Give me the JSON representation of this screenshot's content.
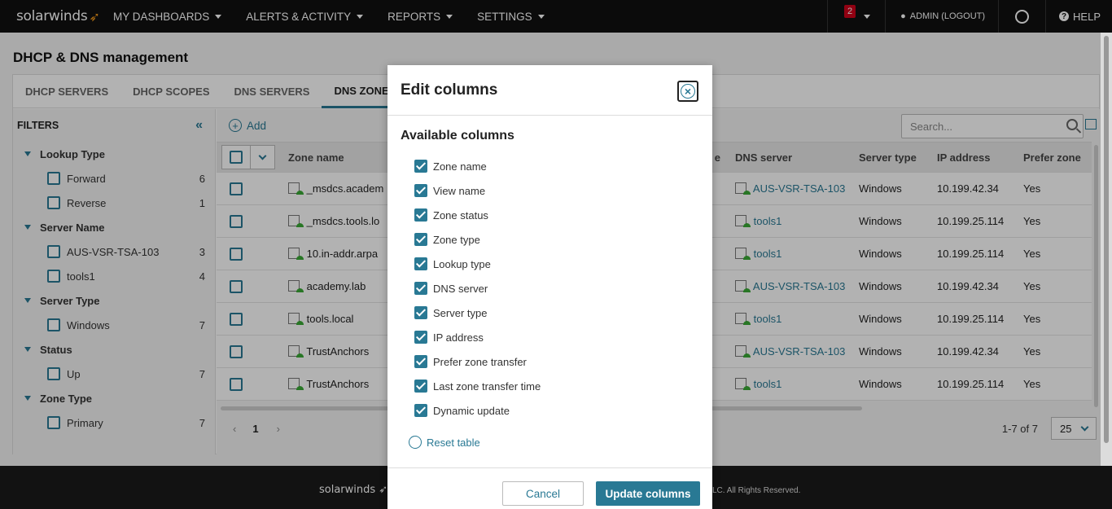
{
  "topbar": {
    "logo": "solarwinds",
    "nav": [
      "MY DASHBOARDS",
      "ALERTS & ACTIVITY",
      "REPORTS",
      "SETTINGS"
    ],
    "alert_count": "2",
    "admin_label": "ADMIN (LOGOUT)",
    "help_label": "HELP",
    "bg_color": "#111111"
  },
  "page": {
    "title": "DHCP & DNS management"
  },
  "tabs": [
    "DHCP SERVERS",
    "DHCP SCOPES",
    "DNS SERVERS",
    "DNS ZONES"
  ],
  "filters": {
    "heading": "FILTERS",
    "groups": [
      {
        "title": "Lookup Type",
        "items": [
          {
            "label": "Forward",
            "count": "6"
          },
          {
            "label": "Reverse",
            "count": "1"
          }
        ]
      },
      {
        "title": "Server Name",
        "items": [
          {
            "label": "AUS-VSR-TSA-103",
            "count": "3"
          },
          {
            "label": "tools1",
            "count": "4"
          }
        ]
      },
      {
        "title": "Server Type",
        "items": [
          {
            "label": "Windows",
            "count": "7"
          }
        ]
      },
      {
        "title": "Status",
        "items": [
          {
            "label": "Up",
            "count": "7"
          }
        ]
      },
      {
        "title": "Zone Type",
        "items": [
          {
            "label": "Primary",
            "count": "7"
          }
        ]
      }
    ]
  },
  "toolbar": {
    "add_label": "Add",
    "search_placeholder": "Search..."
  },
  "grid": {
    "headers": {
      "zone": "Zone name",
      "e_fragment": "e",
      "dns": "DNS server",
      "stype": "Server type",
      "ip": "IP address",
      "prefer": "Prefer zone"
    },
    "rows": [
      {
        "zone": "_msdcs.academ",
        "dns": "AUS-VSR-TSA-103",
        "stype": "Windows",
        "ip": "10.199.42.34",
        "prefer": "Yes"
      },
      {
        "zone": "_msdcs.tools.lo",
        "dns": "tools1",
        "stype": "Windows",
        "ip": "10.199.25.114",
        "prefer": "Yes"
      },
      {
        "zone": "10.in-addr.arpa",
        "dns": "tools1",
        "stype": "Windows",
        "ip": "10.199.25.114",
        "prefer": "Yes"
      },
      {
        "zone": "academy.lab",
        "dns": "AUS-VSR-TSA-103",
        "stype": "Windows",
        "ip": "10.199.42.34",
        "prefer": "Yes"
      },
      {
        "zone": "tools.local",
        "dns": "tools1",
        "stype": "Windows",
        "ip": "10.199.25.114",
        "prefer": "Yes"
      },
      {
        "zone": "TrustAnchors",
        "dns": "AUS-VSR-TSA-103",
        "stype": "Windows",
        "ip": "10.199.42.34",
        "prefer": "Yes"
      },
      {
        "zone": "TrustAnchors",
        "dns": "tools1",
        "stype": "Windows",
        "ip": "10.199.25.114",
        "prefer": "Yes"
      }
    ]
  },
  "pager": {
    "prev": "‹",
    "current": "1",
    "next": "›",
    "range": "1-7 of 7",
    "page_size": "25"
  },
  "footer": {
    "logo": "solarwinds",
    "copyright": "LC. All Rights Reserved."
  },
  "modal": {
    "title": "Edit columns",
    "subtitle": "Available columns",
    "options": [
      "Zone name",
      "View name",
      "Zone status",
      "Zone type",
      "Lookup type",
      "DNS server",
      "Server type",
      "IP address",
      "Prefer zone transfer",
      "Last zone transfer time",
      "Dynamic update"
    ],
    "reset_label": "Reset table",
    "cancel_label": "Cancel",
    "update_label": "Update columns",
    "accent_color": "#297994"
  }
}
